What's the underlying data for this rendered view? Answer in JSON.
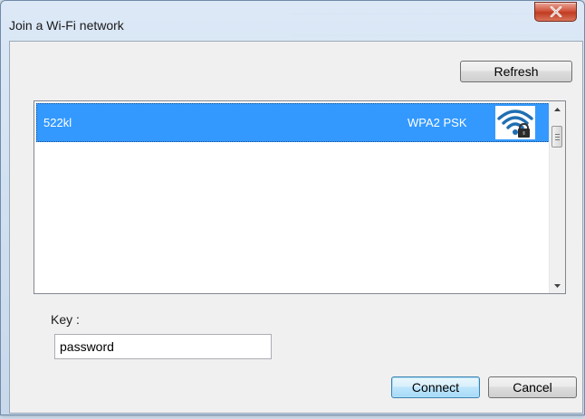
{
  "window": {
    "title": "Join a Wi-Fi network",
    "close_glyph": "x"
  },
  "toolbar": {
    "refresh_label": "Refresh"
  },
  "networks": [
    {
      "ssid": "522kl",
      "security": "WPA2 PSK",
      "signal_icon": "wifi-lock-icon",
      "selected": true
    }
  ],
  "key": {
    "label": "Key :",
    "value": "password"
  },
  "actions": {
    "connect_label": "Connect",
    "cancel_label": "Cancel"
  },
  "colors": {
    "selection": "#3399ff",
    "signal_icon": "#1f6fb2",
    "close_button": "#c9452c"
  }
}
